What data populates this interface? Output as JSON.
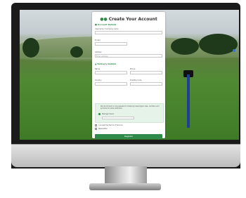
{
  "form": {
    "title": "Create Your Account",
    "section_account": "Account Details",
    "username_label": "Username / Company name",
    "email_label": "E-mail",
    "address_label": "Address",
    "address_placeholder": "Enter address",
    "section_delivery": "Delivery Details",
    "name_label": "Name",
    "phone_label": "Phone",
    "country_label": "Country",
    "postcode_label": "Post/Zip Code",
    "info_text": "We recommend a long password containing lower/upper case, numbers and symbols for extra protection.",
    "radio_label": "Manage Users",
    "terms_label": "I accept the Terms of Service",
    "newsletter_label": "Newsletter",
    "register_button": "Register"
  },
  "colors": {
    "accent": "#2f8a4a"
  }
}
